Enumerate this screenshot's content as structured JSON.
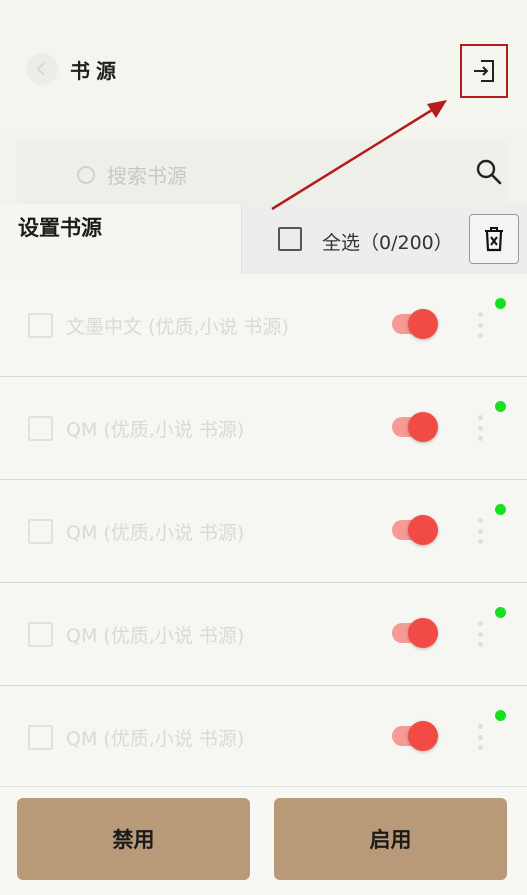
{
  "appbar": {
    "title": "书源"
  },
  "search": {
    "placeholder": "搜索书源"
  },
  "section": {
    "label": "设置书源"
  },
  "selection": {
    "select_all_label": "全选（0/200）"
  },
  "sources": [
    {
      "name": "文墨中文 (优质,小说 书源)",
      "enabled": true,
      "status": "green"
    },
    {
      "name": "QM (优质,小说 书源)",
      "enabled": true,
      "status": "green"
    },
    {
      "name": "QM (优质,小说 书源)",
      "enabled": true,
      "status": "green"
    },
    {
      "name": "QM (优质,小说 书源)",
      "enabled": true,
      "status": "green"
    },
    {
      "name": "QM (优质,小说 书源)",
      "enabled": true,
      "status": "green"
    }
  ],
  "actions": {
    "disable_label": "禁用",
    "enable_label": "启用"
  },
  "colors": {
    "accent_button": "#b99a78",
    "switch_on": "#f24a45",
    "status_ok": "#16e01f",
    "annotation": "#b71c1c"
  }
}
